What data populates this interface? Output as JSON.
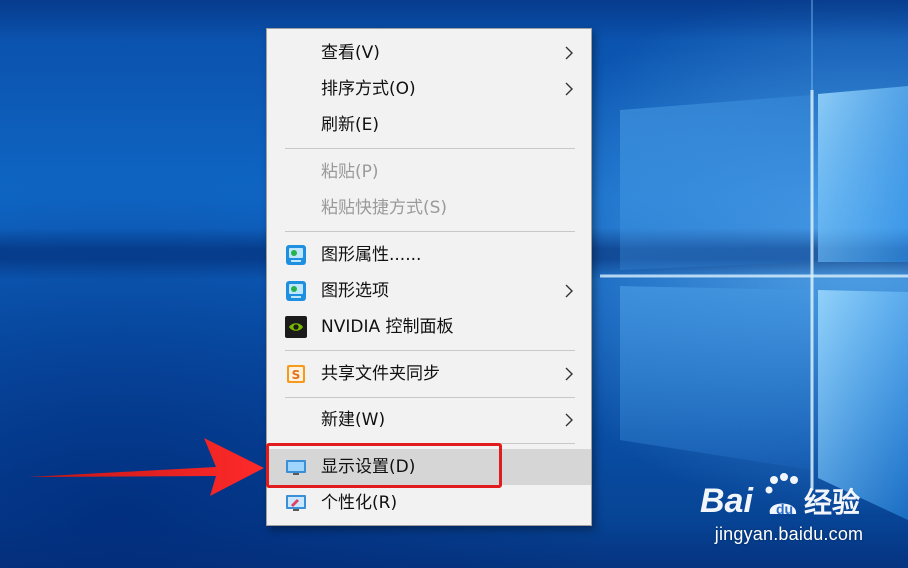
{
  "context_menu": {
    "items": [
      {
        "label": "查看(V)",
        "submenu": true,
        "enabled": true,
        "icon": null
      },
      {
        "label": "排序方式(O)",
        "submenu": true,
        "enabled": true,
        "icon": null
      },
      {
        "label": "刷新(E)",
        "submenu": false,
        "enabled": true,
        "icon": null
      },
      {
        "label": "粘贴(P)",
        "submenu": false,
        "enabled": false,
        "icon": null
      },
      {
        "label": "粘贴快捷方式(S)",
        "submenu": false,
        "enabled": false,
        "icon": null
      },
      {
        "label": "图形属性......",
        "submenu": false,
        "enabled": true,
        "icon": "intel-graphics-icon"
      },
      {
        "label": "图形选项",
        "submenu": true,
        "enabled": true,
        "icon": "intel-graphics-icon"
      },
      {
        "label": "NVIDIA 控制面板",
        "submenu": false,
        "enabled": true,
        "icon": "nvidia-icon"
      },
      {
        "label": "共享文件夹同步",
        "submenu": true,
        "enabled": true,
        "icon": "sync-s-icon"
      },
      {
        "label": "新建(W)",
        "submenu": true,
        "enabled": true,
        "icon": null
      },
      {
        "label": "显示设置(D)",
        "submenu": false,
        "enabled": true,
        "icon": "display-settings-icon",
        "highlighted": true
      },
      {
        "label": "个性化(R)",
        "submenu": false,
        "enabled": true,
        "icon": "personalize-icon"
      }
    ]
  },
  "annotation": {
    "highlight_color": "#e01c1c",
    "arrow_color": "#e01c1c",
    "target_item": "显示设置(D)"
  },
  "watermark": {
    "url": "jingyan.baidu.com"
  },
  "colors": {
    "menu_bg": "#f2f2f2",
    "highlight_bg": "#d6d6d6",
    "desktop_blue": "#0f66c4"
  }
}
